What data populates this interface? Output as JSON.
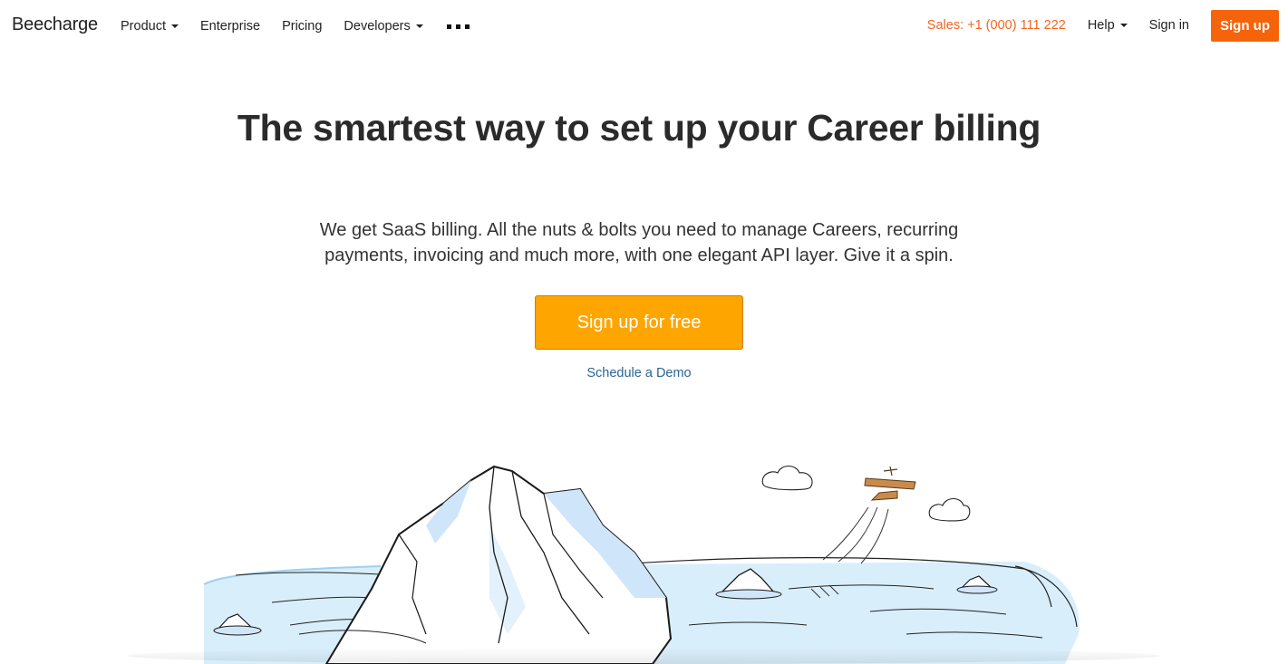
{
  "navbar": {
    "brand": "Beecharge",
    "left_items": [
      {
        "label": "Product",
        "has_caret": true
      },
      {
        "label": "Enterprise",
        "has_caret": false
      },
      {
        "label": "Pricing",
        "has_caret": false
      },
      {
        "label": "Developers",
        "has_caret": true
      }
    ],
    "more_icon": "more-dots-icon",
    "sales": "Sales: +1 (000) 111 222",
    "help": "Help",
    "sign_in": "Sign in",
    "sign_up": "Sign up"
  },
  "hero": {
    "title": "The smartest way to set up your Career billing",
    "subtitle": "We get SaaS billing. All the nuts & bolts you need to manage Careers, recurring payments, invoicing and much more, with one elegant API layer. Give it a spin.",
    "cta_label": "Sign up for free",
    "demo_link": "Schedule a Demo"
  },
  "colors": {
    "sales": "#f26522",
    "signup_button": "#f5640a",
    "cta_button": "#ffa500",
    "link": "#2a6496",
    "water": "#d8eefb"
  },
  "illustration": {
    "elements": [
      "iceberg",
      "water",
      "small-icebergs",
      "clouds",
      "airplane"
    ]
  }
}
